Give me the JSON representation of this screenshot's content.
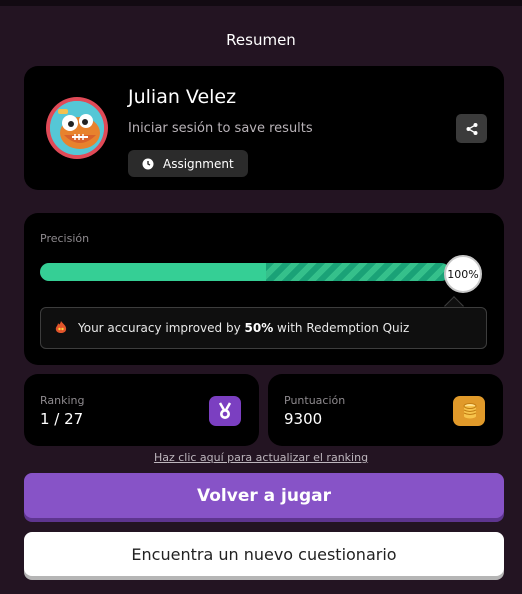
{
  "header": {
    "title": "Resumen"
  },
  "profile": {
    "name": "Julian Velez",
    "login_prompt": "Iniciar sesión to save results",
    "chip_label": "Assignment",
    "avatar_icon": "monster-avatar-icon",
    "share_icon": "share-icon"
  },
  "accuracy": {
    "label": "Precisión",
    "percent_value": 100,
    "percent_text": "100%",
    "improved_fraction": 0.55,
    "note_prefix": "Your accuracy improved by ",
    "note_bold": "50%",
    "note_suffix": " with Redemption Quiz",
    "colors": {
      "bar": "#35cf95",
      "improvement": "#1aa277"
    }
  },
  "stats": {
    "ranking": {
      "label": "Ranking",
      "value": "1 / 27",
      "icon": "medal-icon",
      "color": "#7b3fc1"
    },
    "score": {
      "label": "Puntuación",
      "value": "9300",
      "icon": "coins-icon",
      "color": "#e19a2a"
    }
  },
  "refresh_link": "Haz clic aquí para actualizar el ranking",
  "buttons": {
    "play_again": "Volver a jugar",
    "find_quiz": "Encuentra un nuevo cuestionario"
  }
}
